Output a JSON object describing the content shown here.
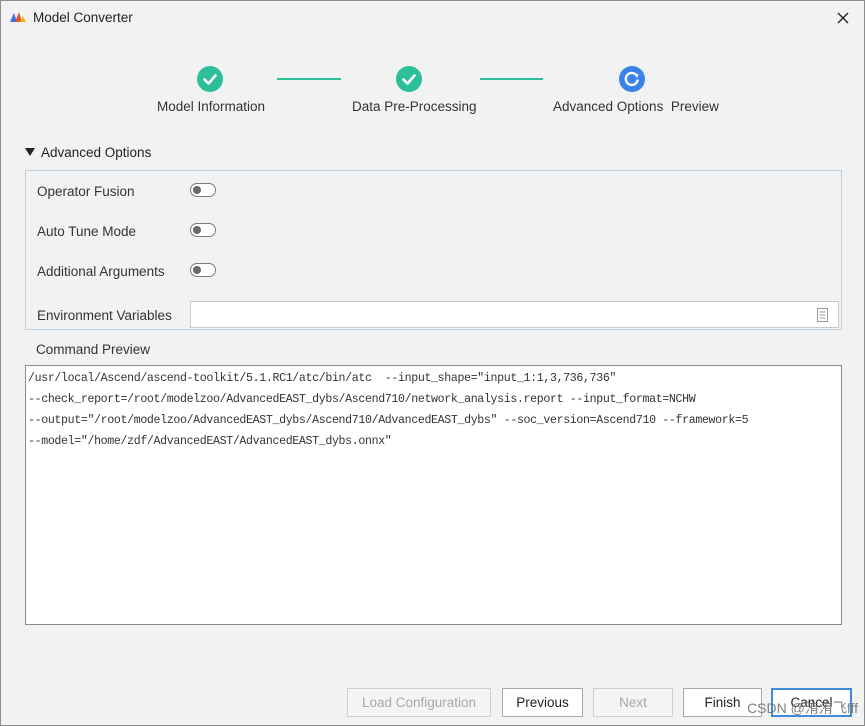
{
  "window": {
    "title": "Model Converter"
  },
  "stepper": {
    "steps": [
      {
        "label": "Model Information",
        "status": "complete"
      },
      {
        "label": "Data Pre-Processing",
        "status": "complete"
      },
      {
        "label": "Advanced Options  Preview",
        "status": "in-progress"
      }
    ],
    "colors": {
      "complete": "#2dbf9a",
      "active": "#3b82e8"
    }
  },
  "advanced": {
    "header": "Advanced Options",
    "options": [
      {
        "label": "Operator Fusion",
        "enabled": false
      },
      {
        "label": "Auto Tune Mode",
        "enabled": false
      },
      {
        "label": "Additional Arguments",
        "enabled": false
      }
    ],
    "env_label": "Environment Variables",
    "env_value": ""
  },
  "command": {
    "label": "Command Preview",
    "lines": [
      "/usr/local/Ascend/ascend-toolkit/5.1.RC1/atc/bin/atc  --input_shape=\"input_1:1,3,736,736\"",
      "--check_report=/root/modelzoo/AdvancedEAST_dybs/Ascend710/network_analysis.report --input_format=NCHW",
      "--output=\"/root/modelzoo/AdvancedEAST_dybs/Ascend710/AdvancedEAST_dybs\" --soc_version=Ascend710 --framework=5",
      "--model=\"/home/zdf/AdvancedEAST/AdvancedEAST_dybs.onnx\""
    ]
  },
  "buttons": {
    "load": "Load Configuration",
    "previous": "Previous",
    "next": "Next",
    "finish": "Finish",
    "cancel": "Cancel"
  },
  "watermark": "CSDN @洧洧飞fff"
}
